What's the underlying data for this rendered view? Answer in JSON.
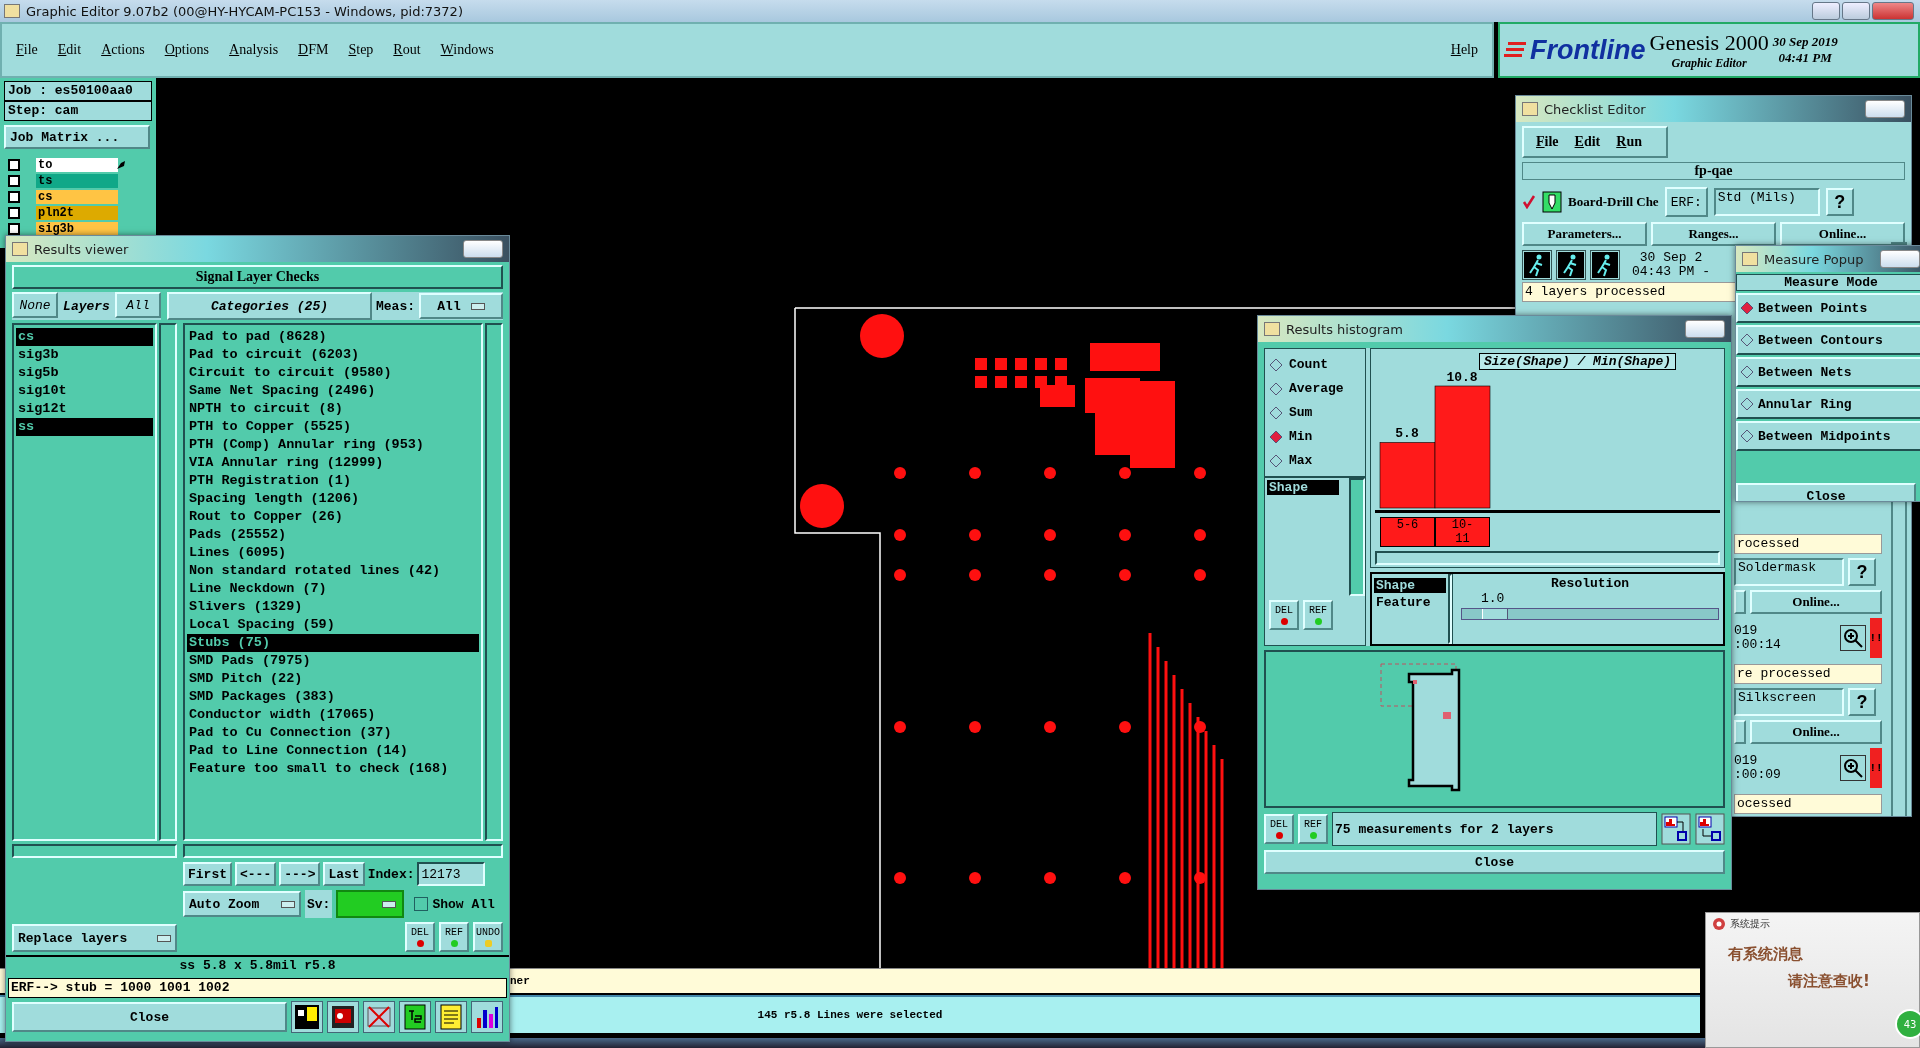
{
  "window": {
    "title": "Graphic Editor 9.07b2 (00@HY-HYCAM-PC153 - Windows, pid:7372)"
  },
  "menu": [
    "File",
    "Edit",
    "Actions",
    "Options",
    "Analysis",
    "DFM",
    "Step",
    "Rout",
    "Windows"
  ],
  "help": "Help",
  "brand": {
    "logo": "Frontline",
    "product": "Genesis 2000",
    "subtitle": "Graphic Editor",
    "date": "30 Sep 2019",
    "time": "04:41 PM"
  },
  "job_panel": {
    "job": "Job : es50100aa0",
    "step": "Step: cam",
    "matrix_button": "Job Matrix ...",
    "layers": [
      {
        "name": "to",
        "checked": false,
        "color": "#ffffff",
        "work": true
      },
      {
        "name": "ts",
        "checked": false,
        "color": "#10a888",
        "work": false
      },
      {
        "name": "cs",
        "checked": false,
        "color": "#ffc444",
        "work": false
      },
      {
        "name": "pln2t",
        "checked": false,
        "color": "#ddaa00",
        "work": false
      },
      {
        "name": "sig3b",
        "checked": false,
        "color": "#ffc444",
        "work": false
      }
    ]
  },
  "results_viewer": {
    "title": "Results viewer",
    "header": "Signal Layer Checks",
    "none_button": "None",
    "layers_label": "Layers",
    "all_button": "All",
    "categories_label": "Categories (25)",
    "meas_label": "Meas:",
    "meas_value": "All",
    "layers": [
      {
        "name": "cs",
        "selected": true
      },
      {
        "name": "sig3b",
        "selected": false
      },
      {
        "name": "sig5b",
        "selected": false
      },
      {
        "name": "sig10t",
        "selected": false
      },
      {
        "name": "sig12t",
        "selected": false
      },
      {
        "name": "ss",
        "selected": true
      }
    ],
    "categories": [
      {
        "label": "Pad to pad (8628)",
        "selected": false
      },
      {
        "label": "Pad to circuit (6203)",
        "selected": false
      },
      {
        "label": "Circuit to circuit (9580)",
        "selected": false
      },
      {
        "label": "Same Net Spacing (2496)",
        "selected": false
      },
      {
        "label": "NPTH to circuit (8)",
        "selected": false
      },
      {
        "label": "PTH to Copper (5525)",
        "selected": false
      },
      {
        "label": "PTH (Comp) Annular ring (953)",
        "selected": false
      },
      {
        "label": "VIA Annular ring (12999)",
        "selected": false
      },
      {
        "label": "PTH Registration (1)",
        "selected": false
      },
      {
        "label": "Spacing length (1206)",
        "selected": false
      },
      {
        "label": "Rout to Copper (26)",
        "selected": false
      },
      {
        "label": "Pads (25552)",
        "selected": false
      },
      {
        "label": "Lines (6095)",
        "selected": false
      },
      {
        "label": "Non standard rotated lines (42)",
        "selected": false
      },
      {
        "label": "Line Neckdown (7)",
        "selected": false
      },
      {
        "label": "Slivers (1329)",
        "selected": false
      },
      {
        "label": "Local Spacing (59)",
        "selected": false
      },
      {
        "label": "Stubs (75)",
        "selected": true
      },
      {
        "label": "SMD Pads (7975)",
        "selected": false
      },
      {
        "label": "SMD Pitch (22)",
        "selected": false
      },
      {
        "label": "SMD Packages (383)",
        "selected": false
      },
      {
        "label": "Conductor width (17065)",
        "selected": false
      },
      {
        "label": "Pad to Cu Connection (37)",
        "selected": false
      },
      {
        "label": "Pad to Line Connection (14)",
        "selected": false
      },
      {
        "label": "Feature too small to check (168)",
        "selected": false
      }
    ],
    "nav_buttons": [
      "First",
      "<---",
      "--->",
      "Last"
    ],
    "index_label": "Index:",
    "index_value": "12173",
    "zoom_mode": "Auto Zoom",
    "sv_label": "Sv:",
    "show_all": {
      "label": "Show All",
      "checked": false
    },
    "replace_mode": "Replace layers",
    "action_buttons": [
      "DEL",
      "REF",
      "UNDO"
    ],
    "info": "ss 5.8 x 5.8mil  r5.8",
    "erf": "ERF--> stub = 1000 1001 1002",
    "close": "Close"
  },
  "histogram": {
    "title": "Results histogram",
    "stats": [
      {
        "label": "Count",
        "selected": false
      },
      {
        "label": "Average",
        "selected": false
      },
      {
        "label": "Sum",
        "selected": false
      },
      {
        "label": "Min",
        "selected": true
      },
      {
        "label": "Max",
        "selected": false
      }
    ],
    "attributes": [
      {
        "label": "Shape",
        "selected": true
      }
    ],
    "chart_data": {
      "type": "bar",
      "title": "Size(Shape) / Min(Shape)",
      "categories": [
        "5-6",
        "10-11"
      ],
      "values": [
        5.8,
        10.8
      ],
      "data_labels": true
    },
    "groupings": [
      {
        "label": "Shape",
        "selected": true
      },
      {
        "label": "Feature",
        "selected": false
      }
    ],
    "resolution_label": "Resolution",
    "resolution_value": "1.0",
    "resolution": {
      "level": 0.08
    },
    "list_buttons": [
      "DEL",
      "REF"
    ],
    "footer_buttons": [
      "DEL",
      "REF"
    ],
    "summary": "75 measurements for 2 layers",
    "close": "Close"
  },
  "checklist_editor": {
    "title": "Checklist Editor",
    "menu": [
      "File",
      "Edit",
      "Run"
    ],
    "checklist": "fp-qae",
    "check": {
      "name": "Board-Drill Che",
      "checked": true,
      "erf": "ERF:",
      "erf_value": "Std (Mils)",
      "help": "?",
      "buttons": [
        "Parameters...",
        "Ranges...",
        "Online..."
      ],
      "date": "30 Sep 2",
      "time": "04:43 PM -",
      "status": "4 layers processed"
    },
    "prev_status": "rocessed",
    "partial_checks": [
      {
        "erf_value": "Soldermask",
        "help": "?",
        "online": "Online...",
        "date": "019",
        "time": ":00:14",
        "alert": "!!",
        "status": "re processed"
      },
      {
        "erf_value": "Silkscreen",
        "help": "?",
        "online": "Online...",
        "date": "019",
        "time": ":00:09",
        "alert": "!!",
        "status": "ocessed"
      }
    ]
  },
  "measure_popup": {
    "title": "Measure Popup",
    "heading": "Measure Mode",
    "options": [
      {
        "label": "Between Points",
        "selected": true
      },
      {
        "label": "Between Contours",
        "selected": false
      },
      {
        "label": "Between Nets",
        "selected": false
      },
      {
        "label": "Annular Ring",
        "selected": false
      },
      {
        "label": "Between Midpoints",
        "selected": false
      }
    ],
    "close": "Close"
  },
  "message_line": "ner",
  "status": "145 r5.8 Lines were selected",
  "notification": {
    "title": "系统提示",
    "line1": "有系统消息",
    "line2": "请注意查收!",
    "badge": "43"
  }
}
